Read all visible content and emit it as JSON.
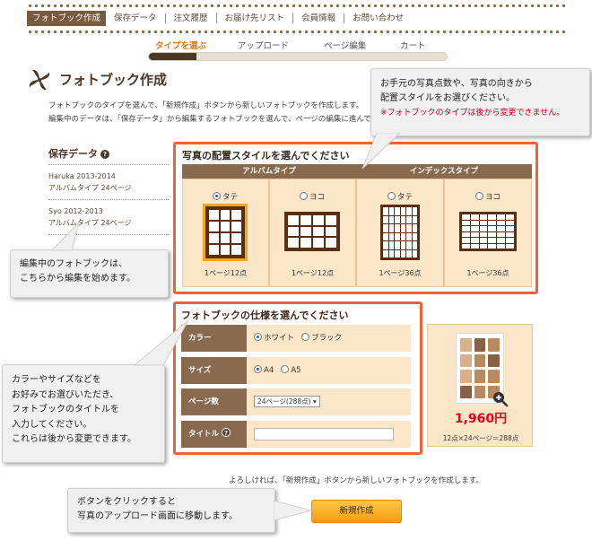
{
  "nav": {
    "items": [
      "フォトブック作成",
      "保存データ",
      "注文履歴",
      "お届け先リスト",
      "会員情報",
      "お問い合わせ"
    ]
  },
  "steps": {
    "items": [
      "タイプを選ぶ",
      "アップロード",
      "ページ編集",
      "カート"
    ],
    "progress": 0.16
  },
  "header": {
    "title": "フォトブック作成",
    "desc1": "フォトブックのタイプを選んで、「新規作成」ボタンから新しいフォトブックを作成します。",
    "desc2": "編集中のデータは、「保存データ」から編集するフォトブックを選んで、ページの編集に進んでく"
  },
  "sidebar": {
    "title": "保存データ",
    "help": "?",
    "items": [
      {
        "name": "Haruka 2013-2014",
        "detail": "アルバムタイプ 24ページ"
      },
      {
        "name": "Syo 2012-2013",
        "detail": "アルバムタイプ 24ページ"
      }
    ]
  },
  "callouts": {
    "top_line1": "お手元の写真点数や、写真の向きから",
    "top_line2": "配置スタイルをお選びください。",
    "top_warn": "※フォトブックのタイプは後から変更できません。",
    "left_line1": "編集中のフォトブックは、",
    "left_line2": "こちらから編集を始めます。",
    "spec_lines": [
      "カラーやサイズなどを",
      "お好みでお選びいただき、",
      "フォトブックのタイトルを",
      "入力してください。",
      "これらは後から変更できます。"
    ],
    "bottom_line1": "ボタンをクリックすると",
    "bottom_line2": "写真のアップロード画面に移動します。"
  },
  "layout_section": {
    "title": "写真の配置スタイルを選んでください",
    "album_header": "アルバムタイプ",
    "index_header": "インデックスタイプ",
    "options": [
      {
        "orientation": "タテ",
        "count": "1ページ12点",
        "selected": true
      },
      {
        "orientation": "ヨコ",
        "count": "1ページ12点",
        "selected": false
      },
      {
        "orientation": "タテ",
        "count": "1ページ36点",
        "selected": false
      },
      {
        "orientation": "ヨコ",
        "count": "1ページ36点",
        "selected": false
      }
    ]
  },
  "spec_section": {
    "title": "フォトブックの仕様を選んでください",
    "color_label": "カラー",
    "color_white": "ホワイト",
    "color_black": "ブラック",
    "size_label": "サイズ",
    "size_a4": "A4",
    "size_a5": "A5",
    "pages_label": "ページ数",
    "pages_value": "24ページ(288点)",
    "title_label": "タイトル",
    "help": "?"
  },
  "preview": {
    "price": "1,960円",
    "calc": "12点×24ページ＝288点"
  },
  "footer": {
    "confirm_text": "よろしければ、「新規作成」ボタンから新しいフォトブックを作成します。",
    "create_button": "新規作成"
  },
  "colors": {
    "brand_brown": "#4a3726",
    "accent_orange": "#f0623a",
    "cell_bg": "#fbe7c7",
    "header_brown": "#8a6a4e",
    "price_red": "#e5001c",
    "warn_red": "#c0001a"
  }
}
